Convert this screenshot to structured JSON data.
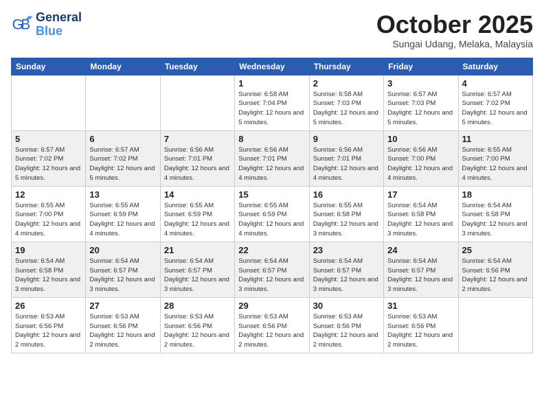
{
  "header": {
    "logo_line1": "General",
    "logo_line2": "Blue",
    "month": "October 2025",
    "location": "Sungai Udang, Melaka, Malaysia"
  },
  "weekdays": [
    "Sunday",
    "Monday",
    "Tuesday",
    "Wednesday",
    "Thursday",
    "Friday",
    "Saturday"
  ],
  "weeks": [
    [
      {
        "day": "",
        "sunrise": "",
        "sunset": "",
        "daylight": ""
      },
      {
        "day": "",
        "sunrise": "",
        "sunset": "",
        "daylight": ""
      },
      {
        "day": "",
        "sunrise": "",
        "sunset": "",
        "daylight": ""
      },
      {
        "day": "1",
        "sunrise": "Sunrise: 6:58 AM",
        "sunset": "Sunset: 7:04 PM",
        "daylight": "Daylight: 12 hours and 5 minutes."
      },
      {
        "day": "2",
        "sunrise": "Sunrise: 6:58 AM",
        "sunset": "Sunset: 7:03 PM",
        "daylight": "Daylight: 12 hours and 5 minutes."
      },
      {
        "day": "3",
        "sunrise": "Sunrise: 6:57 AM",
        "sunset": "Sunset: 7:03 PM",
        "daylight": "Daylight: 12 hours and 5 minutes."
      },
      {
        "day": "4",
        "sunrise": "Sunrise: 6:57 AM",
        "sunset": "Sunset: 7:02 PM",
        "daylight": "Daylight: 12 hours and 5 minutes."
      }
    ],
    [
      {
        "day": "5",
        "sunrise": "Sunrise: 6:57 AM",
        "sunset": "Sunset: 7:02 PM",
        "daylight": "Daylight: 12 hours and 5 minutes."
      },
      {
        "day": "6",
        "sunrise": "Sunrise: 6:57 AM",
        "sunset": "Sunset: 7:02 PM",
        "daylight": "Daylight: 12 hours and 5 minutes."
      },
      {
        "day": "7",
        "sunrise": "Sunrise: 6:56 AM",
        "sunset": "Sunset: 7:01 PM",
        "daylight": "Daylight: 12 hours and 4 minutes."
      },
      {
        "day": "8",
        "sunrise": "Sunrise: 6:56 AM",
        "sunset": "Sunset: 7:01 PM",
        "daylight": "Daylight: 12 hours and 4 minutes."
      },
      {
        "day": "9",
        "sunrise": "Sunrise: 6:56 AM",
        "sunset": "Sunset: 7:01 PM",
        "daylight": "Daylight: 12 hours and 4 minutes."
      },
      {
        "day": "10",
        "sunrise": "Sunrise: 6:56 AM",
        "sunset": "Sunset: 7:00 PM",
        "daylight": "Daylight: 12 hours and 4 minutes."
      },
      {
        "day": "11",
        "sunrise": "Sunrise: 6:55 AM",
        "sunset": "Sunset: 7:00 PM",
        "daylight": "Daylight: 12 hours and 4 minutes."
      }
    ],
    [
      {
        "day": "12",
        "sunrise": "Sunrise: 6:55 AM",
        "sunset": "Sunset: 7:00 PM",
        "daylight": "Daylight: 12 hours and 4 minutes."
      },
      {
        "day": "13",
        "sunrise": "Sunrise: 6:55 AM",
        "sunset": "Sunset: 6:59 PM",
        "daylight": "Daylight: 12 hours and 4 minutes."
      },
      {
        "day": "14",
        "sunrise": "Sunrise: 6:55 AM",
        "sunset": "Sunset: 6:59 PM",
        "daylight": "Daylight: 12 hours and 4 minutes."
      },
      {
        "day": "15",
        "sunrise": "Sunrise: 6:55 AM",
        "sunset": "Sunset: 6:59 PM",
        "daylight": "Daylight: 12 hours and 4 minutes."
      },
      {
        "day": "16",
        "sunrise": "Sunrise: 6:55 AM",
        "sunset": "Sunset: 6:58 PM",
        "daylight": "Daylight: 12 hours and 3 minutes."
      },
      {
        "day": "17",
        "sunrise": "Sunrise: 6:54 AM",
        "sunset": "Sunset: 6:58 PM",
        "daylight": "Daylight: 12 hours and 3 minutes."
      },
      {
        "day": "18",
        "sunrise": "Sunrise: 6:54 AM",
        "sunset": "Sunset: 6:58 PM",
        "daylight": "Daylight: 12 hours and 3 minutes."
      }
    ],
    [
      {
        "day": "19",
        "sunrise": "Sunrise: 6:54 AM",
        "sunset": "Sunset: 6:58 PM",
        "daylight": "Daylight: 12 hours and 3 minutes."
      },
      {
        "day": "20",
        "sunrise": "Sunrise: 6:54 AM",
        "sunset": "Sunset: 6:57 PM",
        "daylight": "Daylight: 12 hours and 3 minutes."
      },
      {
        "day": "21",
        "sunrise": "Sunrise: 6:54 AM",
        "sunset": "Sunset: 6:57 PM",
        "daylight": "Daylight: 12 hours and 3 minutes."
      },
      {
        "day": "22",
        "sunrise": "Sunrise: 6:54 AM",
        "sunset": "Sunset: 6:57 PM",
        "daylight": "Daylight: 12 hours and 3 minutes."
      },
      {
        "day": "23",
        "sunrise": "Sunrise: 6:54 AM",
        "sunset": "Sunset: 6:57 PM",
        "daylight": "Daylight: 12 hours and 3 minutes."
      },
      {
        "day": "24",
        "sunrise": "Sunrise: 6:54 AM",
        "sunset": "Sunset: 6:57 PM",
        "daylight": "Daylight: 12 hours and 3 minutes."
      },
      {
        "day": "25",
        "sunrise": "Sunrise: 6:54 AM",
        "sunset": "Sunset: 6:56 PM",
        "daylight": "Daylight: 12 hours and 2 minutes."
      }
    ],
    [
      {
        "day": "26",
        "sunrise": "Sunrise: 6:53 AM",
        "sunset": "Sunset: 6:56 PM",
        "daylight": "Daylight: 12 hours and 2 minutes."
      },
      {
        "day": "27",
        "sunrise": "Sunrise: 6:53 AM",
        "sunset": "Sunset: 6:56 PM",
        "daylight": "Daylight: 12 hours and 2 minutes."
      },
      {
        "day": "28",
        "sunrise": "Sunrise: 6:53 AM",
        "sunset": "Sunset: 6:56 PM",
        "daylight": "Daylight: 12 hours and 2 minutes."
      },
      {
        "day": "29",
        "sunrise": "Sunrise: 6:53 AM",
        "sunset": "Sunset: 6:56 PM",
        "daylight": "Daylight: 12 hours and 2 minutes."
      },
      {
        "day": "30",
        "sunrise": "Sunrise: 6:53 AM",
        "sunset": "Sunset: 6:56 PM",
        "daylight": "Daylight: 12 hours and 2 minutes."
      },
      {
        "day": "31",
        "sunrise": "Sunrise: 6:53 AM",
        "sunset": "Sunset: 6:56 PM",
        "daylight": "Daylight: 12 hours and 2 minutes."
      },
      {
        "day": "",
        "sunrise": "",
        "sunset": "",
        "daylight": ""
      }
    ]
  ]
}
